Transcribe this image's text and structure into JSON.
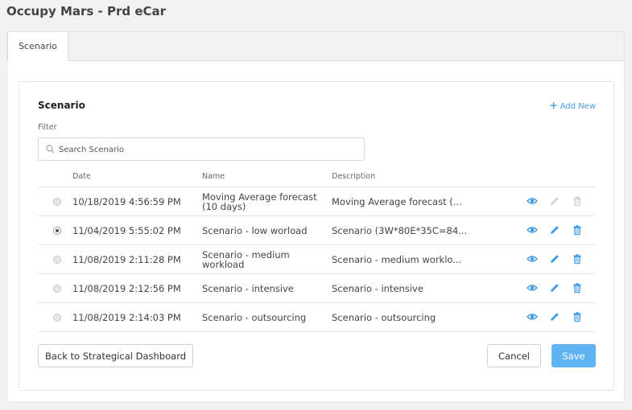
{
  "app": {
    "title": "Occupy Mars - Prd eCar"
  },
  "tabs": [
    {
      "label": "Scenario",
      "active": true
    }
  ],
  "card": {
    "title": "Scenario",
    "add_new_label": "Add New",
    "filter_label": "Filter",
    "search": {
      "placeholder": "Search Scenario",
      "value": ""
    }
  },
  "table": {
    "columns": [
      "Date",
      "Name",
      "Description"
    ],
    "rows": [
      {
        "selected": false,
        "date": "10/18/2019 4:56:59 PM",
        "name": "Moving Average forecast (10 days)",
        "description": "Moving Average forecast (...",
        "actions_enabled": false
      },
      {
        "selected": true,
        "date": "11/04/2019 5:55:02 PM",
        "name": "Scenario - low worload",
        "description": "Scenario (3W*80E*35C=84...",
        "actions_enabled": true
      },
      {
        "selected": false,
        "date": "11/08/2019 2:11:28 PM",
        "name": "Scenario - medium workload",
        "description": "Scenario - medium worklo...",
        "actions_enabled": true
      },
      {
        "selected": false,
        "date": "11/08/2019 2:12:56 PM",
        "name": "Scenario - intensive",
        "description": "Scenario - intensive",
        "actions_enabled": true
      },
      {
        "selected": false,
        "date": "11/08/2019 2:14:03 PM",
        "name": "Scenario - outsourcing",
        "description": "Scenario - outsourcing",
        "actions_enabled": true
      }
    ]
  },
  "buttons": {
    "back": "Back to Strategical Dashboard",
    "cancel": "Cancel",
    "save": "Save"
  },
  "icons": {
    "view": "eye-icon",
    "edit": "pencil-icon",
    "delete": "trash-icon",
    "search": "search-icon",
    "add": "plus-icon"
  },
  "colors": {
    "accent": "#3d9ae8",
    "save_button": "#62b3f2",
    "disabled_icon": "#d0d0d0"
  }
}
